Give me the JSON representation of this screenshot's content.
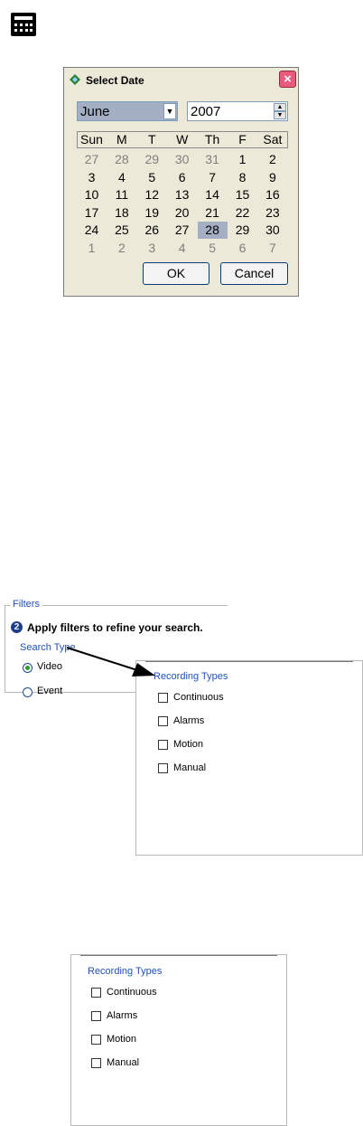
{
  "calendar_icon": {
    "name": "calendar-icon"
  },
  "dialog": {
    "title": "Select Date",
    "close_label": "×",
    "month": "June",
    "year": "2007",
    "weekdays": [
      "Sun",
      "M",
      "T",
      "W",
      "Th",
      "F",
      "Sat"
    ],
    "weeks": [
      [
        "27",
        "28",
        "29",
        "30",
        "31",
        "1",
        "2"
      ],
      [
        "3",
        "4",
        "5",
        "6",
        "7",
        "8",
        "9"
      ],
      [
        "10",
        "11",
        "12",
        "13",
        "14",
        "15",
        "16"
      ],
      [
        "17",
        "18",
        "19",
        "20",
        "21",
        "22",
        "23"
      ],
      [
        "24",
        "25",
        "26",
        "27",
        "28",
        "29",
        "30"
      ],
      [
        "1",
        "2",
        "3",
        "4",
        "5",
        "6",
        "7"
      ]
    ],
    "selected_day": "28",
    "ok_label": "OK",
    "cancel_label": "Cancel"
  },
  "filters": {
    "label": "Filters",
    "step_number": "2",
    "step_text": "Apply filters to refine your search.",
    "search_type_label": "Search Type",
    "options": [
      {
        "label": "Video",
        "selected": true
      },
      {
        "label": "Event",
        "selected": false
      }
    ]
  },
  "recording_types": {
    "title": "Recording Types",
    "items": [
      "Continuous",
      "Alarms",
      "Motion",
      "Manual"
    ]
  },
  "colors": {
    "accent_blue": "#2052b5",
    "selected_day_bg": "#a4afc3",
    "close_red": "#e8597b"
  }
}
